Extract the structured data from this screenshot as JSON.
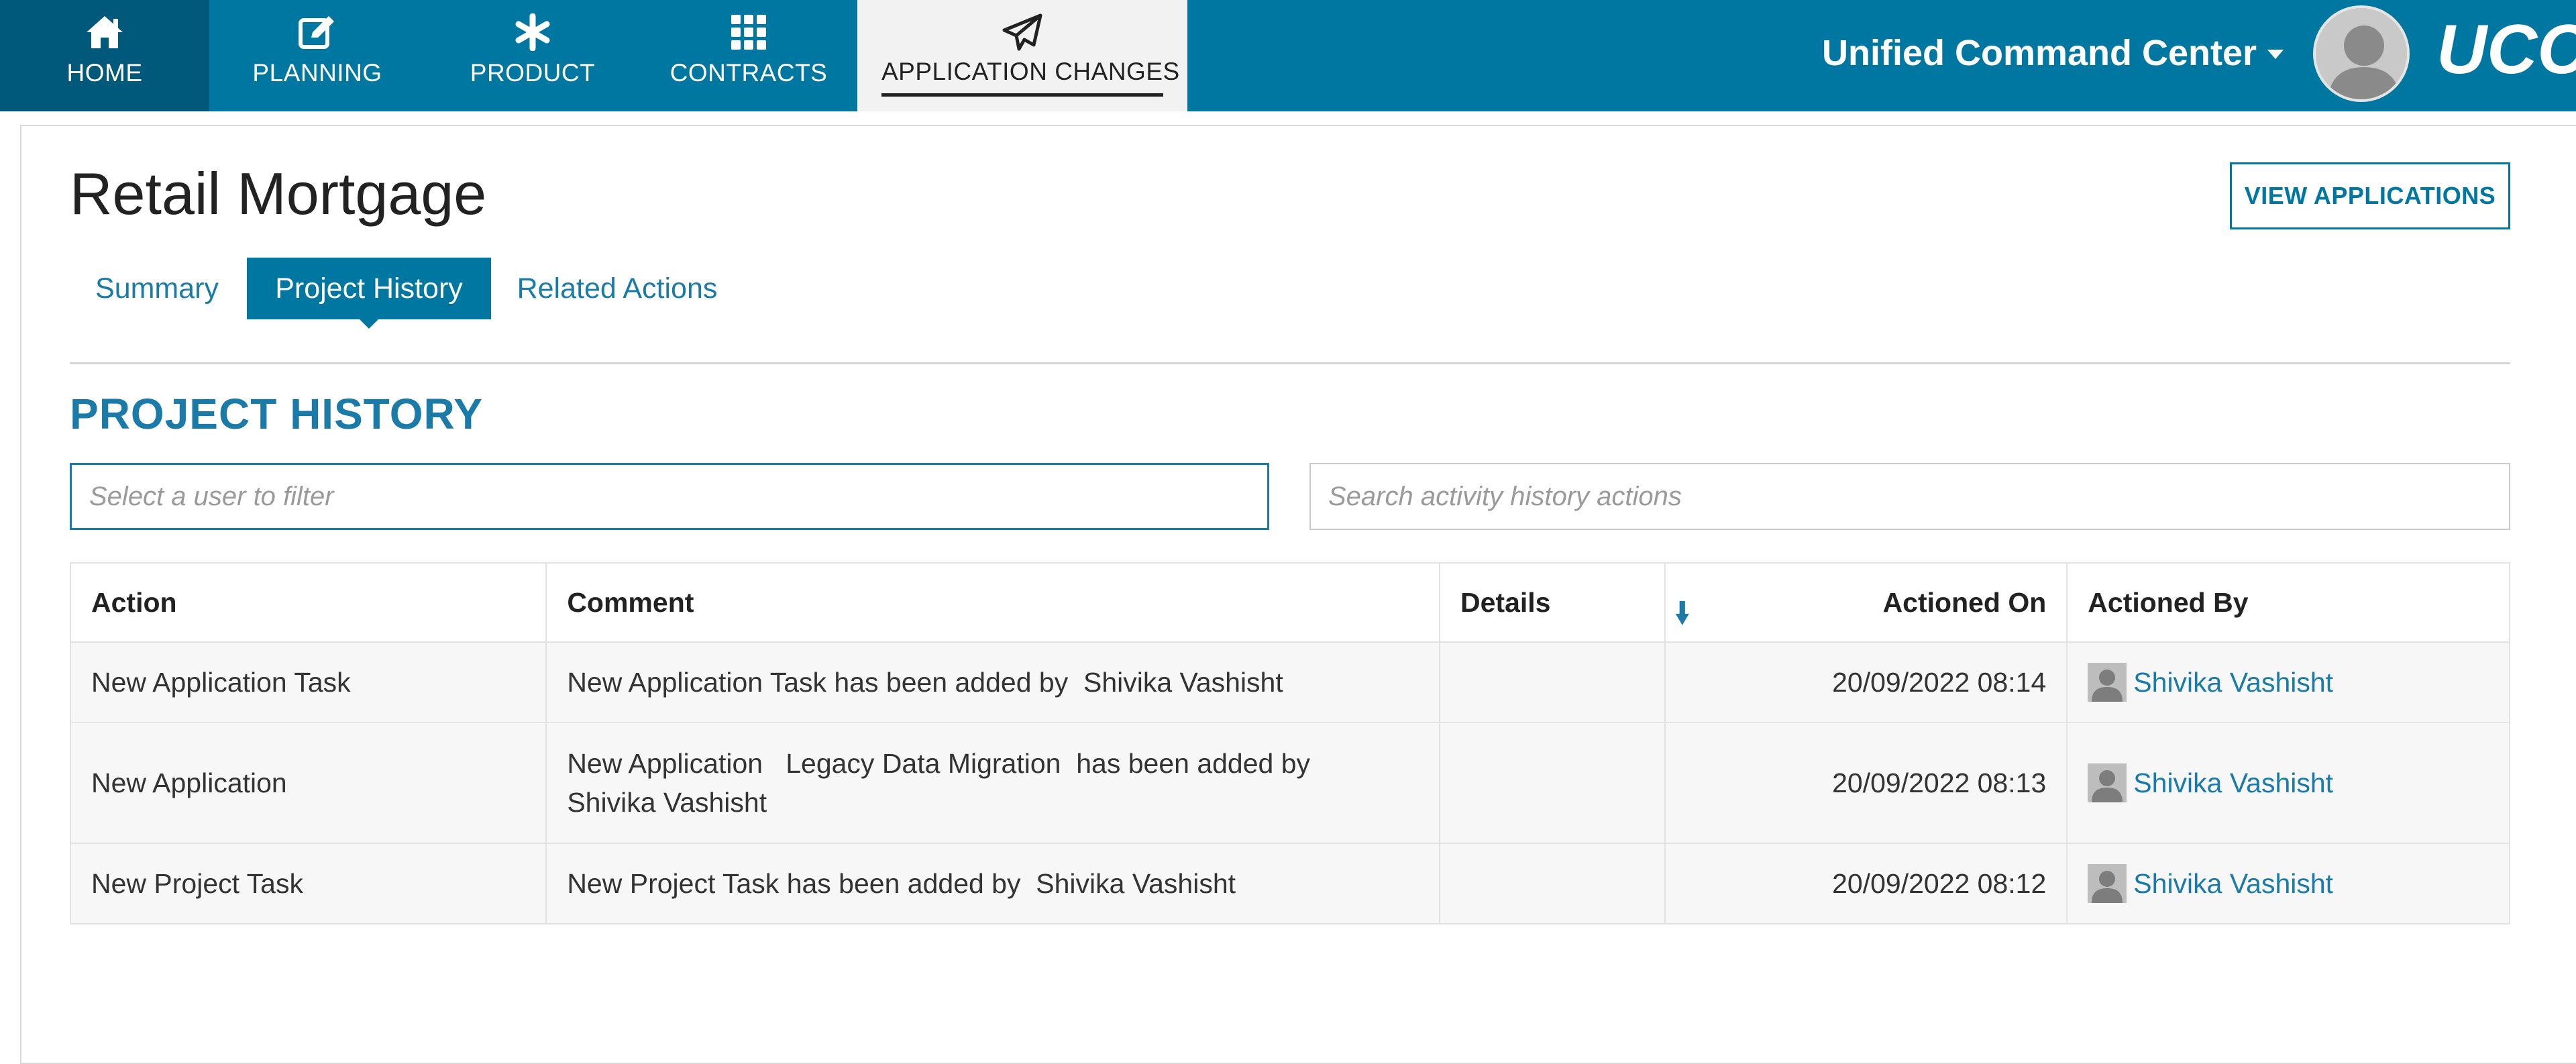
{
  "nav": {
    "items": [
      {
        "label": "HOME",
        "icon": "home-icon"
      },
      {
        "label": "PLANNING",
        "icon": "edit-icon"
      },
      {
        "label": "PRODUCT",
        "icon": "asterisk-icon"
      },
      {
        "label": "CONTRACTS",
        "icon": "grid-icon"
      },
      {
        "label": "APPLICATION CHANGES",
        "icon": "paper-plane-icon"
      }
    ],
    "active": "APPLICATION CHANGES",
    "workspace_title": "Unified Command Center",
    "logo_text": "UCC"
  },
  "page": {
    "title": "Retail Mortgage",
    "view_applications_label": "VIEW APPLICATIONS",
    "tabs": [
      {
        "label": "Summary"
      },
      {
        "label": "Project History"
      },
      {
        "label": "Related Actions"
      }
    ],
    "active_tab": "Project History",
    "section_heading": "PROJECT HISTORY"
  },
  "filters": {
    "user_placeholder": "Select a user to filter",
    "search_placeholder": "Search activity history actions"
  },
  "table": {
    "columns": [
      "Action",
      "Comment",
      "Details",
      "Actioned On",
      "Actioned By"
    ],
    "sort_icon": "arrow-down-icon",
    "rows": [
      {
        "action": "New Application Task",
        "comment": "New Application Task has been added by  Shivika Vashisht",
        "details": "",
        "actioned_on": "20/09/2022 08:14",
        "actioned_by": "Shivika Vashisht"
      },
      {
        "action": "New Application",
        "comment": "New Application   Legacy Data Migration  has been added by Shivika Vashisht",
        "details": "",
        "actioned_on": "20/09/2022 08:13",
        "actioned_by": "Shivika Vashisht"
      },
      {
        "action": "New Project Task",
        "comment": "New Project Task has been added by  Shivika Vashisht",
        "details": "",
        "actioned_on": "20/09/2022 08:12",
        "actioned_by": "Shivika Vashisht"
      }
    ]
  },
  "colors": {
    "brand": "#0077a1",
    "brand_dark": "#00587a",
    "link": "#1a7aa8"
  }
}
